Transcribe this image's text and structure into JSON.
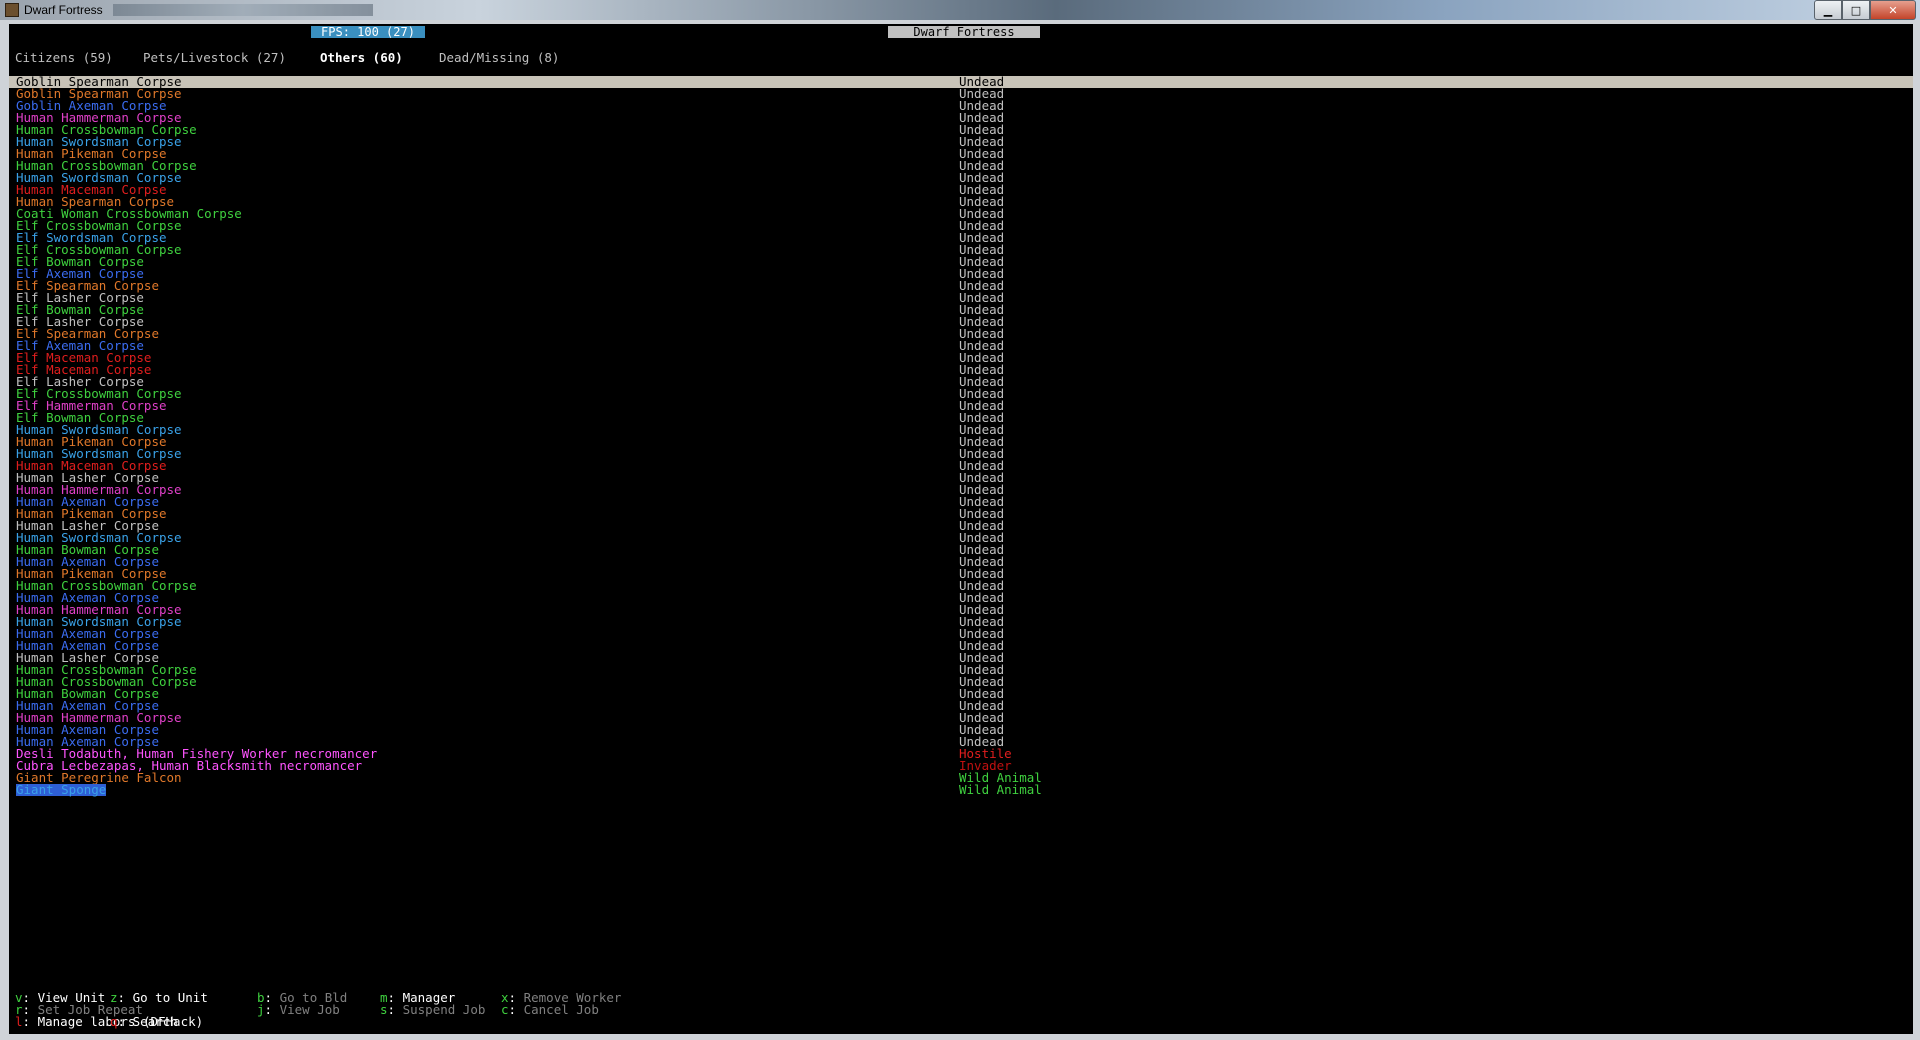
{
  "window": {
    "title": "Dwarf Fortress"
  },
  "header": {
    "fps": "FPS: 100 (27)",
    "title": "Dwarf Fortress"
  },
  "tabs": [
    {
      "label": "Citizens (59)",
      "active": false
    },
    {
      "label": "Pets/Livestock (27)",
      "active": false
    },
    {
      "label": "Others (60)",
      "active": true
    },
    {
      "label": "Dead/Missing (8)",
      "active": false
    }
  ],
  "units": [
    {
      "name": "Goblin Spearman Corpse",
      "color": "lgray",
      "status": "Undead",
      "status_color": "lgray",
      "selected": true
    },
    {
      "name": "Goblin Spearman Corpse",
      "color": "orange",
      "status": "Undead",
      "status_color": "lgray"
    },
    {
      "name": "Goblin Axeman Corpse",
      "color": "blue",
      "status": "Undead",
      "status_color": "lgray"
    },
    {
      "name": "Human Hammerman Corpse",
      "color": "magenta",
      "status": "Undead",
      "status_color": "lgray"
    },
    {
      "name": "Human Crossbowman Corpse",
      "color": "green",
      "status": "Undead",
      "status_color": "lgray"
    },
    {
      "name": "Human Swordsman Corpse",
      "color": "lblue",
      "status": "Undead",
      "status_color": "lgray"
    },
    {
      "name": "Human Pikeman Corpse",
      "color": "orange",
      "status": "Undead",
      "status_color": "lgray"
    },
    {
      "name": "Human Crossbowman Corpse",
      "color": "green",
      "status": "Undead",
      "status_color": "lgray"
    },
    {
      "name": "Human Swordsman Corpse",
      "color": "lblue",
      "status": "Undead",
      "status_color": "lgray"
    },
    {
      "name": "Human Maceman Corpse",
      "color": "red",
      "status": "Undead",
      "status_color": "lgray"
    },
    {
      "name": "Human Spearman Corpse",
      "color": "orange",
      "status": "Undead",
      "status_color": "lgray"
    },
    {
      "name": "Coati Woman Crossbowman Corpse",
      "color": "green",
      "status": "Undead",
      "status_color": "lgray"
    },
    {
      "name": "Elf Crossbowman Corpse",
      "color": "green",
      "status": "Undead",
      "status_color": "lgray"
    },
    {
      "name": "Elf Swordsman Corpse",
      "color": "lblue",
      "status": "Undead",
      "status_color": "lgray"
    },
    {
      "name": "Elf Crossbowman Corpse",
      "color": "green",
      "status": "Undead",
      "status_color": "lgray"
    },
    {
      "name": "Elf Bowman Corpse",
      "color": "green",
      "status": "Undead",
      "status_color": "lgray"
    },
    {
      "name": "Elf Axeman Corpse",
      "color": "blue",
      "status": "Undead",
      "status_color": "lgray"
    },
    {
      "name": "Elf Spearman Corpse",
      "color": "orange",
      "status": "Undead",
      "status_color": "lgray"
    },
    {
      "name": "Elf Lasher Corpse",
      "color": "lgray",
      "status": "Undead",
      "status_color": "lgray"
    },
    {
      "name": "Elf Bowman Corpse",
      "color": "green",
      "status": "Undead",
      "status_color": "lgray"
    },
    {
      "name": "Elf Lasher Corpse",
      "color": "lgray",
      "status": "Undead",
      "status_color": "lgray"
    },
    {
      "name": "Elf Spearman Corpse",
      "color": "orange",
      "status": "Undead",
      "status_color": "lgray"
    },
    {
      "name": "Elf Axeman Corpse",
      "color": "blue",
      "status": "Undead",
      "status_color": "lgray"
    },
    {
      "name": "Elf Maceman Corpse",
      "color": "red",
      "status": "Undead",
      "status_color": "lgray"
    },
    {
      "name": "Elf Maceman Corpse",
      "color": "red",
      "status": "Undead",
      "status_color": "lgray"
    },
    {
      "name": "Elf Lasher Corpse",
      "color": "lgray",
      "status": "Undead",
      "status_color": "lgray"
    },
    {
      "name": "Elf Crossbowman Corpse",
      "color": "green",
      "status": "Undead",
      "status_color": "lgray"
    },
    {
      "name": "Elf Hammerman Corpse",
      "color": "magenta",
      "status": "Undead",
      "status_color": "lgray"
    },
    {
      "name": "Elf Bowman Corpse",
      "color": "green",
      "status": "Undead",
      "status_color": "lgray"
    },
    {
      "name": "Human Swordsman Corpse",
      "color": "lblue",
      "status": "Undead",
      "status_color": "lgray"
    },
    {
      "name": "Human Pikeman Corpse",
      "color": "orange",
      "status": "Undead",
      "status_color": "lgray"
    },
    {
      "name": "Human Swordsman Corpse",
      "color": "lblue",
      "status": "Undead",
      "status_color": "lgray"
    },
    {
      "name": "Human Maceman Corpse",
      "color": "red",
      "status": "Undead",
      "status_color": "lgray"
    },
    {
      "name": "Human Lasher Corpse",
      "color": "lgray",
      "status": "Undead",
      "status_color": "lgray"
    },
    {
      "name": "Human Hammerman Corpse",
      "color": "magenta",
      "status": "Undead",
      "status_color": "lgray"
    },
    {
      "name": "Human Axeman Corpse",
      "color": "blue",
      "status": "Undead",
      "status_color": "lgray"
    },
    {
      "name": "Human Pikeman Corpse",
      "color": "orange",
      "status": "Undead",
      "status_color": "lgray"
    },
    {
      "name": "Human Lasher Corpse",
      "color": "lgray",
      "status": "Undead",
      "status_color": "lgray"
    },
    {
      "name": "Human Swordsman Corpse",
      "color": "lblue",
      "status": "Undead",
      "status_color": "lgray"
    },
    {
      "name": "Human Bowman Corpse",
      "color": "green",
      "status": "Undead",
      "status_color": "lgray"
    },
    {
      "name": "Human Axeman Corpse",
      "color": "blue",
      "status": "Undead",
      "status_color": "lgray"
    },
    {
      "name": "Human Pikeman Corpse",
      "color": "orange",
      "status": "Undead",
      "status_color": "lgray"
    },
    {
      "name": "Human Crossbowman Corpse",
      "color": "green",
      "status": "Undead",
      "status_color": "lgray"
    },
    {
      "name": "Human Axeman Corpse",
      "color": "blue",
      "status": "Undead",
      "status_color": "lgray"
    },
    {
      "name": "Human Hammerman Corpse",
      "color": "magenta",
      "status": "Undead",
      "status_color": "lgray"
    },
    {
      "name": "Human Swordsman Corpse",
      "color": "lblue",
      "status": "Undead",
      "status_color": "lgray"
    },
    {
      "name": "Human Axeman Corpse",
      "color": "blue",
      "status": "Undead",
      "status_color": "lgray"
    },
    {
      "name": "Human Axeman Corpse",
      "color": "blue",
      "status": "Undead",
      "status_color": "lgray"
    },
    {
      "name": "Human Lasher Corpse",
      "color": "lgray",
      "status": "Undead",
      "status_color": "lgray"
    },
    {
      "name": "Human Crossbowman Corpse",
      "color": "green",
      "status": "Undead",
      "status_color": "lgray"
    },
    {
      "name": "Human Crossbowman Corpse",
      "color": "green",
      "status": "Undead",
      "status_color": "lgray"
    },
    {
      "name": "Human Bowman Corpse",
      "color": "green",
      "status": "Undead",
      "status_color": "lgray"
    },
    {
      "name": "Human Axeman Corpse",
      "color": "blue",
      "status": "Undead",
      "status_color": "lgray"
    },
    {
      "name": "Human Hammerman Corpse",
      "color": "magenta",
      "status": "Undead",
      "status_color": "lgray"
    },
    {
      "name": "Human Axeman Corpse",
      "color": "blue",
      "status": "Undead",
      "status_color": "lgray"
    },
    {
      "name": "Human Axeman Corpse",
      "color": "blue",
      "status": "Undead",
      "status_color": "lgray"
    },
    {
      "name": "Desli Todabuth, Human Fishery Worker necromancer",
      "color": "brightmag",
      "status": "Hostile",
      "status_color": "red"
    },
    {
      "name": "Cubra Lecbezapas, Human Blacksmith necromancer",
      "color": "brightmag",
      "status": "Invader",
      "status_color": "dred"
    },
    {
      "name": "Giant Peregrine Falcon",
      "color": "orange",
      "status": "Wild Animal",
      "status_color": "green"
    },
    {
      "name": "Giant Sponge",
      "color": "lblue",
      "status": "Wild Animal",
      "status_color": "green",
      "highlight": true
    }
  ],
  "footer": {
    "items": [
      {
        "key": "v",
        "label": "View Unit",
        "enabled": true,
        "key_color": "green"
      },
      {
        "key": "z",
        "label": "Go to Unit",
        "enabled": true,
        "key_color": "green"
      },
      {
        "key": "b",
        "label": "Go to Bld",
        "enabled": false,
        "key_color": "green"
      },
      {
        "key": "m",
        "label": "Manager",
        "enabled": true,
        "key_color": "green"
      },
      {
        "key": "x",
        "label": "Remove Worker",
        "enabled": false,
        "key_color": "green"
      },
      {
        "key": "r",
        "label": "Set Job Repeat",
        "enabled": false,
        "key_color": "green"
      },
      {
        "key": "j",
        "label": "View Job",
        "enabled": false,
        "key_color": "green"
      },
      {
        "key": "s",
        "label": "Suspend Job",
        "enabled": false,
        "key_color": "green"
      },
      {
        "key": "c",
        "label": "Cancel Job",
        "enabled": false,
        "key_color": "green"
      },
      {
        "key": "l",
        "label": "Manage labors (DFHack)",
        "enabled": true,
        "key_color": "red"
      },
      {
        "key": "q",
        "label": "Search",
        "enabled": true,
        "key_color": "red"
      }
    ]
  }
}
